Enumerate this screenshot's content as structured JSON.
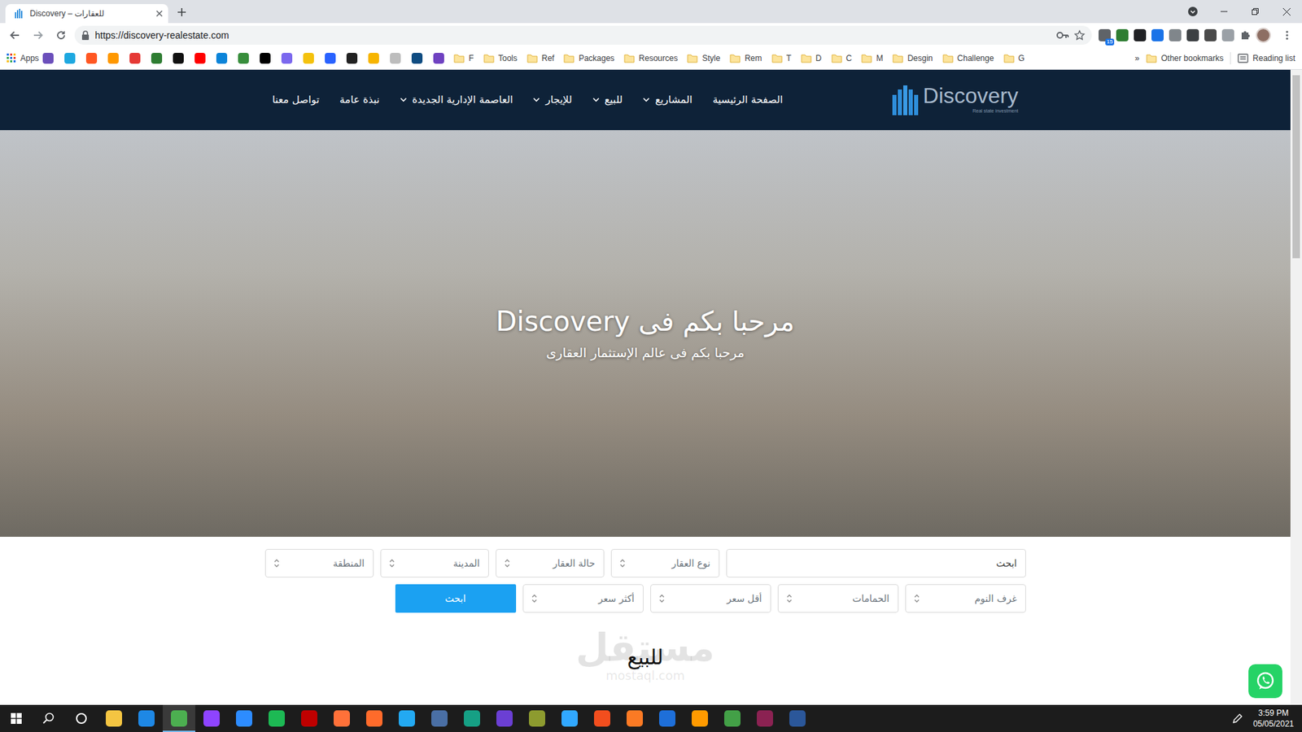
{
  "browser": {
    "tab": {
      "title": "Discovery – للعقارات",
      "selected": true
    },
    "url": "https://discovery-realestate.com",
    "extensions": [
      {
        "color": "#5f6368",
        "badge": "15"
      },
      {
        "color": "#2e7d32",
        "badge": ""
      },
      {
        "color": "#202124",
        "badge": ""
      },
      {
        "color": "#1a73e8",
        "badge": ""
      },
      {
        "color": "#80868b",
        "badge": ""
      },
      {
        "color": "#3c4043",
        "badge": ""
      },
      {
        "color": "#4a4a4a",
        "badge": ""
      },
      {
        "color": "#9aa0a6",
        "badge": ""
      }
    ],
    "bookmarks": {
      "apps": "Apps",
      "favicons": [
        {
          "color": "#6b4fbb"
        },
        {
          "color": "#1ea8e0"
        },
        {
          "color": "#ff5722"
        },
        {
          "color": "#ff9800"
        },
        {
          "color": "#e53935"
        },
        {
          "color": "#2e7d32"
        },
        {
          "color": "#111111"
        },
        {
          "color": "#ff0000"
        },
        {
          "color": "#0b84d9"
        },
        {
          "color": "#388e3c"
        },
        {
          "color": "#000000"
        },
        {
          "color": "#7b68ee"
        },
        {
          "color": "#f4c20d"
        },
        {
          "color": "#2962ff"
        },
        {
          "color": "#222222"
        },
        {
          "color": "#f7b500"
        },
        {
          "color": "#bdbdbd"
        },
        {
          "color": "#0f4c81"
        },
        {
          "color": "#6f42c1"
        }
      ],
      "folders": [
        "F",
        "Tools",
        "Ref",
        "Packages",
        "Resources",
        "Style",
        "Rem",
        "T",
        "D",
        "C",
        "M",
        "Desgin",
        "Challenge",
        "G"
      ],
      "overflow": "»",
      "other": "Other bookmarks",
      "reading_list": "Reading list"
    }
  },
  "site": {
    "logo": {
      "name": "Discovery",
      "tagline": "Real state investment"
    },
    "nav": [
      {
        "label": "الصفحة الرئيسية",
        "kind": "link"
      },
      {
        "label": "المشاريع",
        "kind": "dropdown"
      },
      {
        "label": "للبيع",
        "kind": "dropdown"
      },
      {
        "label": "للإيجار",
        "kind": "dropdown"
      },
      {
        "label": "العاصمة الإدارية الجديدة",
        "kind": "dropdown"
      },
      {
        "label": "نبذة عامة",
        "kind": "link"
      },
      {
        "label": "تواصل معنا",
        "kind": "link"
      }
    ],
    "hero": {
      "title": "مرحبا بكم فى Discovery",
      "subtitle": "مرحبا بكم فى عالم الإستثمار العقارى"
    },
    "search": {
      "rows": [
        [
          {
            "kind": "input",
            "placeholder": "ابحث"
          },
          {
            "kind": "select",
            "label": "نوع العقار"
          },
          {
            "kind": "select",
            "label": "حالة العقار"
          },
          {
            "kind": "select",
            "label": "المدينة"
          },
          {
            "kind": "select",
            "label": "المنطقة"
          }
        ],
        [
          {
            "kind": "select",
            "label": "غرف النوم"
          },
          {
            "kind": "select",
            "label": "الحمامات"
          },
          {
            "kind": "select",
            "label": "أقل سعر"
          },
          {
            "kind": "select",
            "label": "أكثر سعر"
          },
          {
            "kind": "button",
            "label": "ابحث"
          }
        ]
      ]
    },
    "section_title": "للبيع",
    "watermark": {
      "arabic": "مستقل",
      "latin": "mostaql.com"
    }
  },
  "taskbar": {
    "apps": [
      {
        "color": "#f4c542",
        "selected": false
      },
      {
        "color": "#1e88e5",
        "selected": false
      },
      {
        "color": "#4caf50",
        "selected": true
      },
      {
        "color": "#8e44ff",
        "selected": false
      },
      {
        "color": "#2d8cff",
        "selected": false
      },
      {
        "color": "#1db954",
        "selected": false
      },
      {
        "color": "#bf0000",
        "selected": false
      },
      {
        "color": "#ff7139",
        "selected": false
      },
      {
        "color": "#ff6b2b",
        "selected": false
      },
      {
        "color": "#23a9f2",
        "selected": false
      },
      {
        "color": "#4a6fa5",
        "selected": false
      },
      {
        "color": "#16a085",
        "selected": false
      },
      {
        "color": "#6b3fd4",
        "selected": false
      },
      {
        "color": "#8d9b2f",
        "selected": false
      },
      {
        "color": "#31a8ff",
        "selected": false
      },
      {
        "color": "#f24e1e",
        "selected": false
      },
      {
        "color": "#fb7a24",
        "selected": false
      },
      {
        "color": "#1e6fd9",
        "selected": false
      },
      {
        "color": "#ff9a00",
        "selected": false
      },
      {
        "color": "#43a047",
        "selected": false
      },
      {
        "color": "#8b2252",
        "selected": false
      },
      {
        "color": "#2b579a",
        "selected": false
      }
    ],
    "time": "3:59 PM",
    "date": "05/05/2021"
  }
}
